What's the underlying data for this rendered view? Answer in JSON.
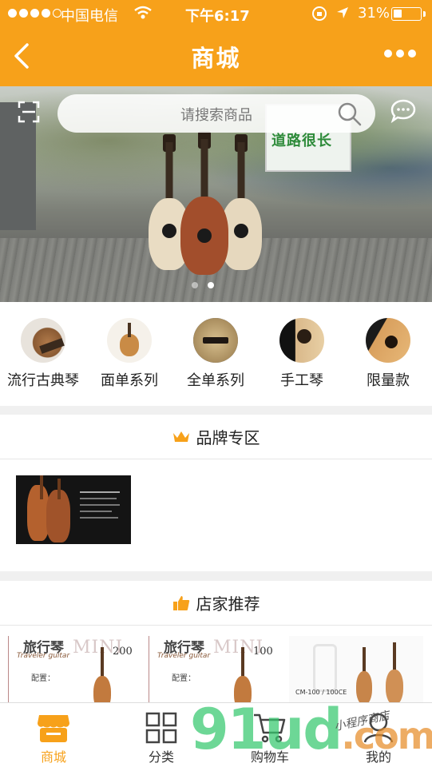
{
  "status_bar": {
    "carrier": "中国电信",
    "time": "下午6:17",
    "battery_percent": "31%",
    "battery_level": 0.31
  },
  "nav": {
    "title": "商城"
  },
  "search": {
    "placeholder": "请搜索商品"
  },
  "banner": {
    "poster_text": "道路很长",
    "page_count": 2,
    "active_page": 2
  },
  "categories": [
    {
      "label": "流行古典琴",
      "icon": "classical-guitar-thumb"
    },
    {
      "label": "面单系列",
      "icon": "ukulele-thumb"
    },
    {
      "label": "全单系列",
      "icon": "bridge-thumb"
    },
    {
      "label": "手工琴",
      "icon": "handmade-guitar-thumb"
    },
    {
      "label": "限量款",
      "icon": "limited-guitar-thumb"
    }
  ],
  "brand_section": {
    "title": "品牌专区",
    "icon": "crown-icon"
  },
  "recommend_section": {
    "title": "店家推荐",
    "icon": "thumbs-up-icon",
    "items": [
      {
        "title": "旅行琴",
        "subtitle": "Traveler guitar",
        "mini": "MINI",
        "model": "200",
        "config": "配置："
      },
      {
        "title": "旅行琴",
        "subtitle": "Traveler guitar",
        "mini": "MINI",
        "model": "100",
        "config": "配置："
      },
      {
        "model_label": "CM-100 / 100CE"
      }
    ]
  },
  "tabbar": {
    "tabs": [
      {
        "label": "商城",
        "active": true
      },
      {
        "label": "分类",
        "active": false
      },
      {
        "label": "购物车",
        "active": false
      },
      {
        "label": "我的",
        "active": false
      }
    ]
  },
  "watermark": {
    "main": "91ud",
    "suffix": ".com",
    "signature": "小程序商店"
  },
  "colors": {
    "brand_orange": "#f7a11a",
    "background": "#f0f0f0"
  }
}
